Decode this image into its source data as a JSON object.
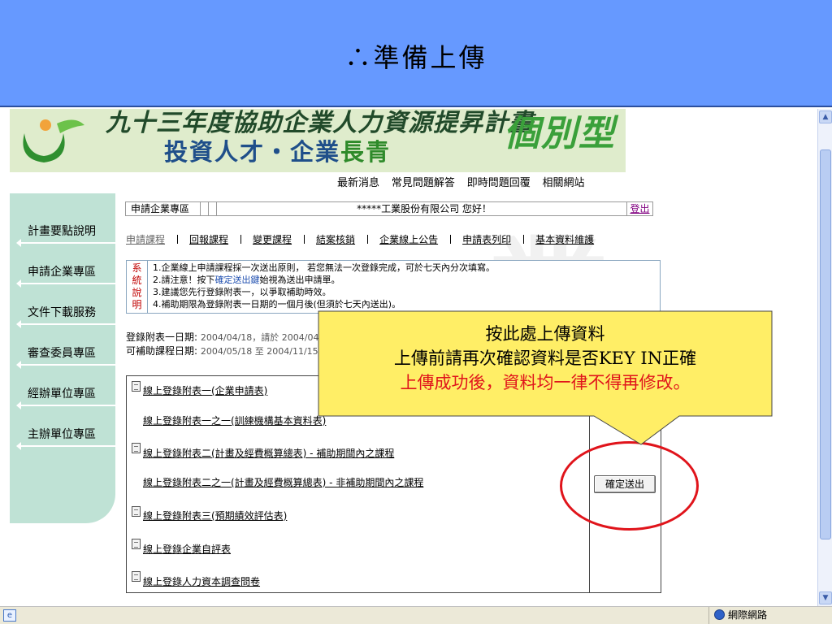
{
  "slide": {
    "title": "∴準備上傳"
  },
  "banner": {
    "line1": "九十三年度協助企業人力資源提昇計畫",
    "line2_a": "投資人才・企業",
    "line2_b": "長青",
    "badge": "個別型"
  },
  "topnav": [
    "最新消息",
    "常見問題解答",
    "即時問題回覆",
    "相關網站"
  ],
  "sidebar": [
    "計畫要點說明",
    "申請企業專區",
    "文件下載服務",
    "審查委員專區",
    "經辦單位專區",
    "主辦單位專區"
  ],
  "member": {
    "area": "申請企業專區",
    "greeting": "*****工業股份有限公司 您好！",
    "logout": "登出"
  },
  "subnav": [
    "申請課程",
    "回報課程",
    "變更課程",
    "結案核銷",
    "企業線上公告",
    "申請表列印",
    "基本資料維護"
  ],
  "notice": {
    "label": [
      "系",
      "統",
      "說",
      "明"
    ],
    "line1": "1.企業線上申請課程採一次送出原則， 若您無法一次登錄完成，可於七天內分次填寫。",
    "line2_a": "2.請注意！按下",
    "line2_b": "確定送出鍵",
    "line2_c": "始視為送出申請單。",
    "line3": "3.建議您先行登錄附表一，以爭取補助時效。",
    "line4": "4.補助期限為登錄附表一日期的一個月後(但須於七天內送出)。"
  },
  "dates": {
    "l1_label": "登錄附表一日期:",
    "l1_value": "2004/04/18，請於 2004/04/",
    "l2_label": "可補助課程日期:",
    "l2_value": "2004/05/18 至 2004/11/15"
  },
  "forms": [
    "線上登錄附表一(企業申請表)",
    "線上登錄附表一之一(訓練機構基本資料表)",
    "線上登錄附表二(計畫及經費概算總表)   -   補助期間內之課程",
    "線上登錄附表二之一(計畫及經費概算總表)   -   非補助期間內之課程",
    "線上登錄附表三(預期績效評估表)",
    "線上登錄企業自評表",
    "線上登錄人力資本調查問卷"
  ],
  "confirm_button": "確定送出",
  "callout": {
    "line1": "按此處上傳資料",
    "line2": "上傳前請再次確認資料是否KEY IN正確",
    "line3": "上傳成功後，資料均一律不得再修改。"
  },
  "statusbar": {
    "zone": "網際網路"
  },
  "colors": {
    "header_bg": "#6699ff",
    "callout_bg": "#ffee66",
    "highlight_red": "#e0141b",
    "sidebar_bg": "#bfe2d5"
  }
}
